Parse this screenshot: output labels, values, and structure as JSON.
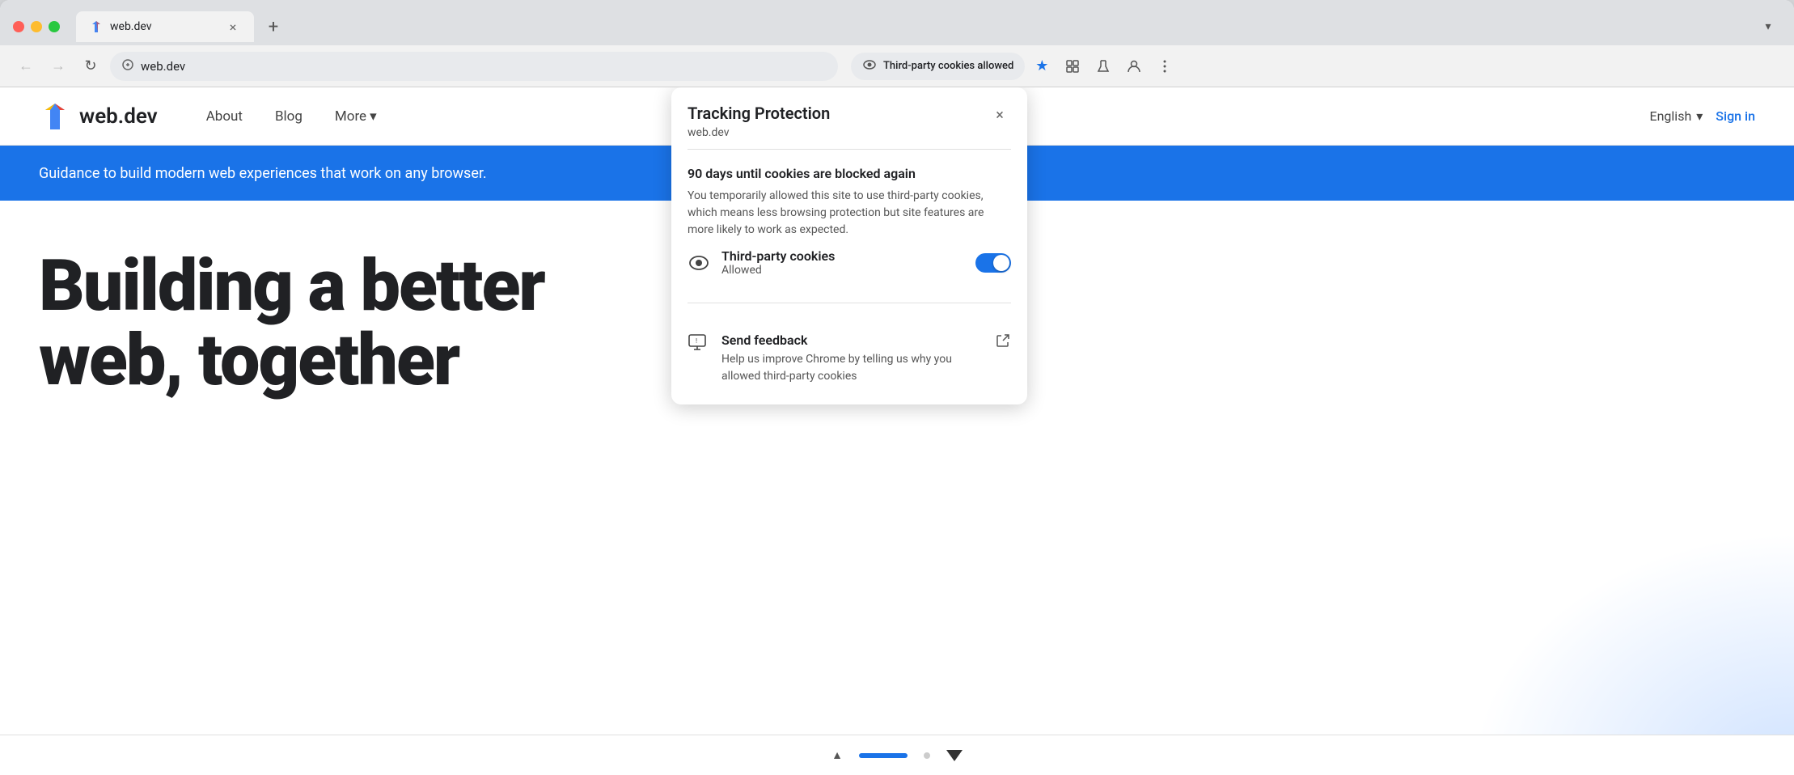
{
  "browser": {
    "tab": {
      "favicon_label": "web.dev favicon",
      "title": "web.dev",
      "close_label": "×",
      "new_tab_label": "+"
    },
    "tab_dropdown_label": "▾",
    "toolbar": {
      "back_label": "←",
      "forward_label": "→",
      "reload_label": "↻",
      "address_icon_label": "⊕",
      "address": "web.dev",
      "cookies_badge": {
        "icon_label": "👁",
        "text": "Third-party cookies allowed"
      },
      "star_label": "★",
      "extensions_label": "🧩",
      "lab_label": "⚗",
      "profile_label": "👤",
      "menu_label": "⋮"
    }
  },
  "site": {
    "logo_text": "web.dev",
    "nav": {
      "about": "About",
      "blog": "Blog",
      "more": "More",
      "more_dropdown": "▾"
    },
    "lang_button": "English",
    "lang_dropdown": "▾",
    "sign_in": "Sign in",
    "hero_banner": "Guidance to build modern web experiences that work on any browser.",
    "hero_heading_line1": "Building a better",
    "hero_heading_line2": "web, together"
  },
  "popup": {
    "title": "Tracking Protection",
    "domain": "web.dev",
    "close_label": "×",
    "section1": {
      "days_title": "90 days until cookies are blocked again",
      "days_desc": "You temporarily allowed this site to use third-party cookies, which means less browsing protection but site features are more likely to work as expected."
    },
    "section2": {
      "eye_icon_label": "eye-icon",
      "cookie_label": "Third-party cookies",
      "cookie_status": "Allowed",
      "toggle_on": true
    },
    "section3": {
      "feedback_icon_label": "feedback-icon",
      "feedback_label": "Send feedback",
      "feedback_desc": "Help us improve Chrome by telling us why you allowed third-party cookies",
      "ext_icon_label": "external-link-icon"
    }
  }
}
